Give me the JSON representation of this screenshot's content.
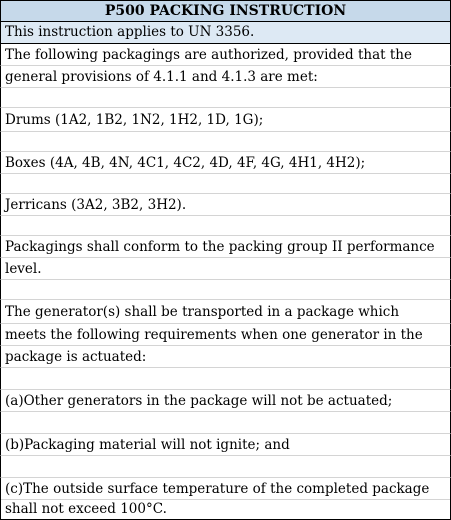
{
  "title": "P500 PACKING INSTRUCTION",
  "applies": "This instruction applies to UN 3356.",
  "lines": [
    "The following packagings are authorized, provided that the",
    "general provisions of 4.1.1 and 4.1.3 are met:",
    "Drums (1A2, 1B2, 1N2, 1H2, 1D, 1G);",
    "Boxes (4A, 4B, 4N, 4C1, 4C2, 4D, 4F, 4G, 4H1, 4H2);",
    "Jerricans (3A2, 3B2, 3H2).",
    "Packagings shall conform to the packing group II performance",
    "level.",
    "The generator(s) shall be transported in a package which",
    "meets the following requirements when one generator in the",
    "package is actuated:",
    "(a)Other generators in the package will not be actuated;",
    "(b)Packaging material will not ignite; and",
    "(c)The outside surface temperature of the completed package",
    "shall not exceed 100°C."
  ]
}
